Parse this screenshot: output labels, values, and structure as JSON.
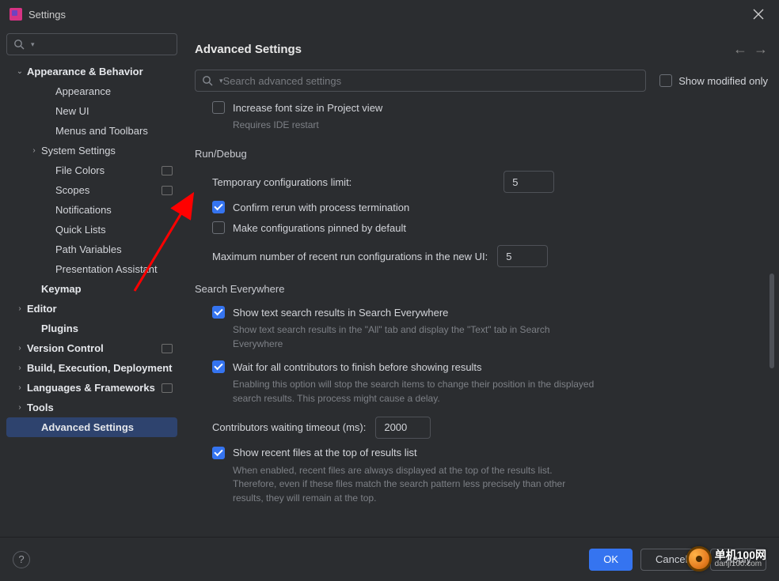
{
  "window": {
    "title": "Settings"
  },
  "header": {
    "title": "Advanced Settings",
    "search_placeholder": "Search advanced settings",
    "show_modified_label": "Show modified only"
  },
  "sidebar": {
    "items": [
      {
        "label": "Appearance & Behavior",
        "bold": true,
        "chevron": "down",
        "pad": 1
      },
      {
        "label": "Appearance",
        "pad": 3
      },
      {
        "label": "New UI",
        "pad": 3
      },
      {
        "label": "Menus and Toolbars",
        "pad": 3
      },
      {
        "label": "System Settings",
        "chevron": "right",
        "pad": 2
      },
      {
        "label": "File Colors",
        "pad": 3,
        "badge": true
      },
      {
        "label": "Scopes",
        "pad": 3,
        "badge": true
      },
      {
        "label": "Notifications",
        "pad": 3
      },
      {
        "label": "Quick Lists",
        "pad": 3
      },
      {
        "label": "Path Variables",
        "pad": 3
      },
      {
        "label": "Presentation Assistant",
        "pad": 3
      },
      {
        "label": "Keymap",
        "bold": true,
        "pad": 2
      },
      {
        "label": "Editor",
        "bold": true,
        "chevron": "right",
        "pad": 1
      },
      {
        "label": "Plugins",
        "bold": true,
        "pad": 2
      },
      {
        "label": "Version Control",
        "bold": true,
        "chevron": "right",
        "pad": 1,
        "badge": true
      },
      {
        "label": "Build, Execution, Deployment",
        "bold": true,
        "chevron": "right",
        "pad": 1
      },
      {
        "label": "Languages & Frameworks",
        "bold": true,
        "chevron": "right",
        "pad": 1,
        "badge": true
      },
      {
        "label": "Tools",
        "bold": true,
        "chevron": "right",
        "pad": 1
      },
      {
        "label": "Advanced Settings",
        "bold": true,
        "pad": 2,
        "selected": true
      }
    ]
  },
  "content": {
    "increase_font_label": "Increase font size in Project view",
    "increase_font_hint": "Requires IDE restart",
    "run_debug_heading": "Run/Debug",
    "temp_config_label": "Temporary configurations limit:",
    "temp_config_value": "5",
    "confirm_rerun_label": "Confirm rerun with process termination",
    "make_pinned_label": "Make configurations pinned by default",
    "max_recent_label": "Maximum number of recent run configurations in the new UI:",
    "max_recent_value": "5",
    "search_everywhere_heading": "Search Everywhere",
    "show_text_search_label": "Show text search results in Search Everywhere",
    "show_text_search_hint": "Show text search results in the \"All\" tab and display the \"Text\" tab in Search Everywhere",
    "wait_contrib_label": "Wait for all contributors to finish before showing results",
    "wait_contrib_hint": "Enabling this option will stop the search items to change their position in the displayed search results. This process might cause a delay.",
    "contrib_timeout_label": "Contributors waiting timeout (ms):",
    "contrib_timeout_value": "2000",
    "show_recent_label": "Show recent files at the top of results list",
    "show_recent_hint": "When enabled, recent files are always displayed at the top of the results list. Therefore, even if these files match the search pattern less precisely than other results, they will remain at the top."
  },
  "footer": {
    "ok": "OK",
    "cancel": "Cancel",
    "apply": "Apply"
  },
  "watermark": {
    "cn": "单机100网",
    "url": "danji100.com"
  }
}
